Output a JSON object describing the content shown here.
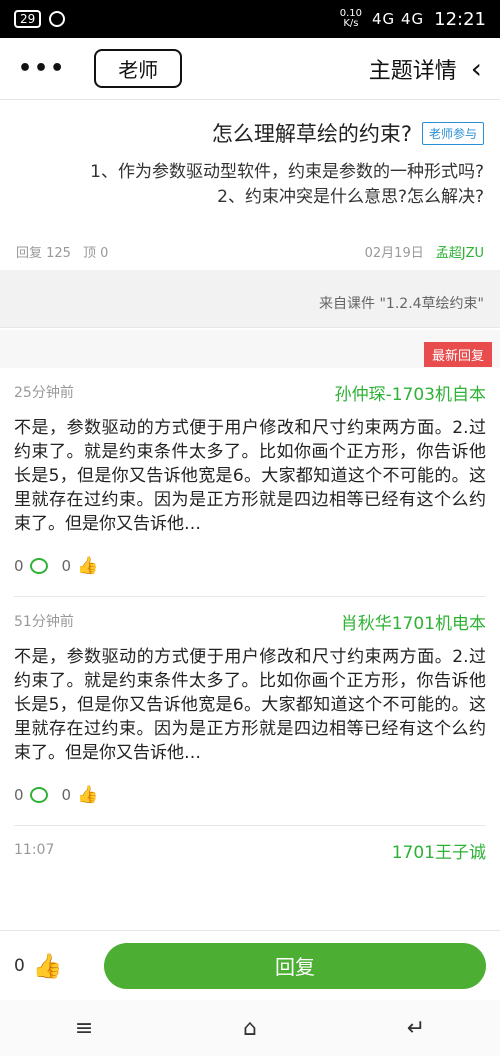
{
  "status_bar": {
    "battery": "29",
    "signal": "4G 4G",
    "net_rate_value": "0.10",
    "net_rate_unit": "K/s",
    "time": "12:21"
  },
  "header": {
    "more": "•••",
    "teacher_button": "老师",
    "title": "主题详情",
    "back": "‹"
  },
  "topic": {
    "tag": "老师参与",
    "title": "怎么理解草绘的约束?",
    "body_line1": "1、作为参数驱动型软件，约束是参数的一种形式吗?",
    "body_line2": "2、约束冲突是什么意思?怎么解决?",
    "author": "孟超JZU",
    "date": "02月19日",
    "views": "顶 0",
    "replies": "回复 125"
  },
  "source": {
    "text": "来自课件 \"1.2.4草绘约束\""
  },
  "newest_tag": "最新回复",
  "comments": [
    {
      "author": "孙仲琛-1703机自本",
      "time": "25分钟前",
      "text": "不是，参数驱动的方式便于用户修改和尺寸约束两方面。2.过约束了。就是约束条件太多了。比如你画个正方形，你告诉他长是5，但是你又告诉他宽是6。大家都知道这个不可能的。这里就存在过约束。因为是正方形就是四边相等已经有这个么约束了。但是你又告诉他…",
      "likes": "0",
      "comments_count": "0"
    },
    {
      "author": "肖秋华1701机电本",
      "time": "51分钟前",
      "text": "不是，参数驱动的方式便于用户修改和尺寸约束两方面。2.过约束了。就是约束条件太多了。比如你画个正方形，你告诉他长是5，但是你又告诉他宽是6。大家都知道这个不可能的。这里就存在过约束。因为是正方形就是四边相等已经有这个么约束了。但是你又告诉他…",
      "likes": "0",
      "comments_count": "0"
    },
    {
      "author": "1701王子诚",
      "time": "11:07"
    }
  ],
  "bottom": {
    "likes": "0",
    "reply_button": "回复"
  },
  "nav": {
    "menu": "≡",
    "home": "⌂",
    "back": "↵"
  }
}
